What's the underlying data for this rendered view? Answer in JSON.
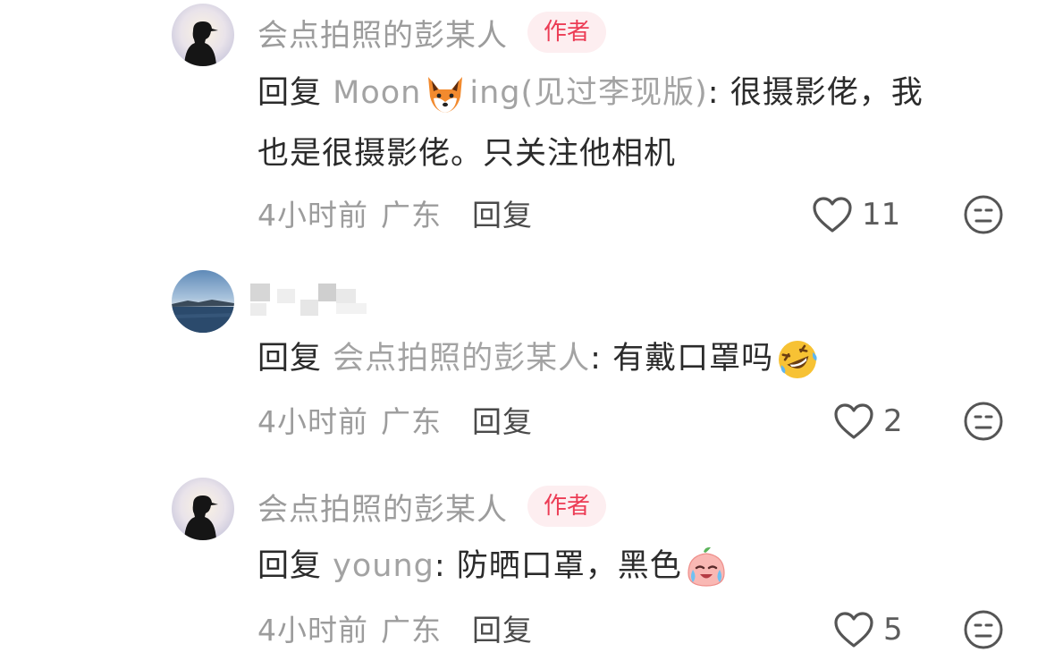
{
  "comments": [
    {
      "username": "会点拍照的彭某人",
      "badge": "作者",
      "reply_prefix": "回复 ",
      "reply_to_a": "Moon",
      "reply_to_b": "ing(见过李现版)",
      "reply_sep": ": ",
      "content_line1": "很摄影佬，我",
      "content_line2": "也是很摄影佬。只关注他相机",
      "time": "4小时前",
      "location": "广东",
      "reply_label": "回复",
      "likes": "11",
      "avatar": "silhouette-cap-avatar",
      "emoji": "fox-emoji"
    },
    {
      "username": "",
      "reply_prefix": "回复 ",
      "reply_to": "会点拍照的彭某人",
      "reply_sep": ": ",
      "content": "有戴口罩吗",
      "time": "4小时前",
      "location": "广东",
      "reply_label": "回复",
      "likes": "2",
      "avatar": "lake-sky-avatar",
      "emoji": "rolling-laughing-emoji"
    },
    {
      "username": "会点拍照的彭某人",
      "badge": "作者",
      "reply_prefix": "回复 ",
      "reply_to": "young",
      "reply_sep": ": ",
      "content": "防晒口罩，黑色",
      "time": "4小时前",
      "location": "广东",
      "reply_label": "回复",
      "likes": "5",
      "avatar": "silhouette-cap-avatar",
      "emoji": "crying-peach-emoji"
    }
  ],
  "colors": {
    "badge_text": "#ec3c55",
    "badge_bg": "#fdeef0",
    "muted_text": "#9c9c9c",
    "body_text": "#2b2b2b"
  }
}
